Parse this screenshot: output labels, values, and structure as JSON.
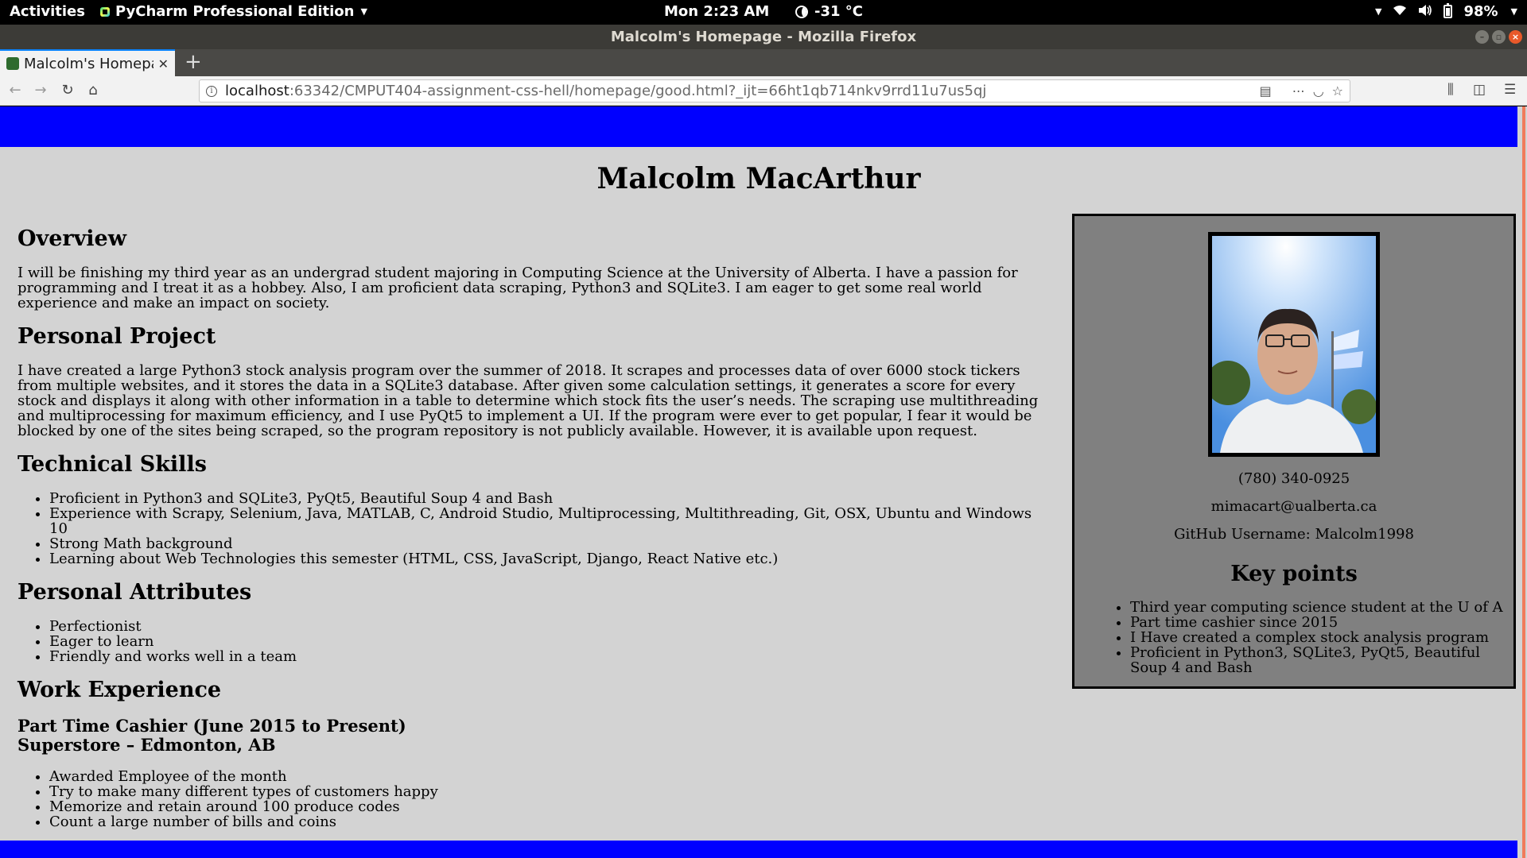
{
  "topbar": {
    "activities": "Activities",
    "app_name": "PyCharm Professional Edition",
    "clock": "Mon  2:23 AM",
    "weather": "-31 °C",
    "battery": "98%"
  },
  "window": {
    "title": "Malcolm's Homepage - Mozilla Firefox"
  },
  "tab": {
    "title": "Malcolm's Homepage"
  },
  "urlbar": {
    "host": "localhost",
    "rest": ":63342/CMPUT404-assignment-css-hell/homepage/good.html?_ijt=66ht1qb714nkv9rrd11u7us5qj"
  },
  "page": {
    "name": "Malcolm MacArthur",
    "overview": {
      "heading": "Overview",
      "text": "I will be finishing my third year as an undergrad student majoring in Computing Science at the University of Alberta. I have a passion for programming and I treat it as a hobbey. Also, I am proficient data scraping, Python3 and SQLite3. I am eager to get some real world experience and make an impact on society."
    },
    "project": {
      "heading": "Personal Project",
      "text": "I have created a large Python3 stock analysis program over the summer of 2018. It scrapes and processes data of over 6000 stock tickers from multiple websites, and it stores the data in a SQLite3 database. After given some calculation settings, it generates a score for every stock and displays it along with other information in a table to determine which stock fits the user’s needs. The scraping use multithreading and multiprocessing for maximum efficiency, and I use PyQt5 to implement a UI. If the program were ever to get popular, I fear it would be blocked by one of the sites being scraped, so the program repository is not publicly available. However, it is available upon request."
    },
    "skills": {
      "heading": "Technical Skills",
      "items": [
        "Proficient in Python3 and SQLite3, PyQt5, Beautiful Soup 4 and Bash",
        "Experience with Scrapy, Selenium, Java, MATLAB, C, Android Studio, Multiprocessing, Multithreading, Git, OSX, Ubuntu and Windows 10",
        "Strong Math background",
        "Learning about Web Technologies this semester (HTML, CSS, JavaScript, Django, React Native etc.)"
      ]
    },
    "attributes": {
      "heading": "Personal Attributes",
      "items": [
        "Perfectionist",
        "Eager to learn",
        "Friendly and works well in a team"
      ]
    },
    "work": {
      "heading": "Work Experience",
      "job_title": "Part Time Cashier (June 2015 to Present)",
      "job_place": "Superstore – Edmonton, AB",
      "items": [
        "Awarded Employee of the month",
        "Try to make many different types of customers happy",
        "Memorize and retain around 100 produce codes",
        "Count a large number of bills and coins"
      ]
    }
  },
  "sidebar": {
    "phone": "(780) 340-0925",
    "email": "mimacart@ualberta.ca",
    "github": "GitHub Username: Malcolm1998",
    "key_heading": "Key points",
    "key_points": [
      "Third year computing science student at the U of A",
      "Part time cashier since 2015",
      "I Have created a complex stock analysis program",
      "Proficient in Python3, SQLite3, PyQt5, Beautiful Soup 4 and Bash"
    ]
  },
  "colors": {
    "band": "#0000ff",
    "page_bg": "#d3d3d3",
    "sidebar_bg": "#808080"
  }
}
